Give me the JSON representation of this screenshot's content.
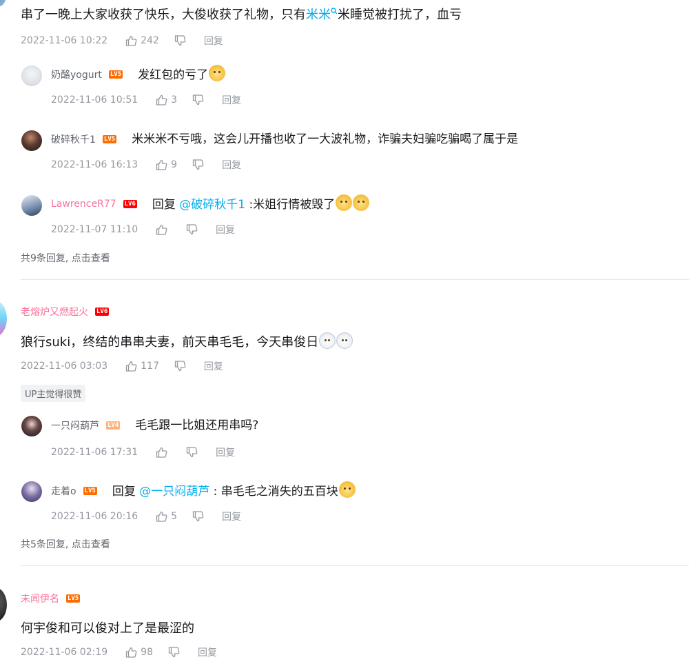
{
  "colors": {
    "accent_link": "#00aeec",
    "vip_name": "#fb7299",
    "meta": "#9499a0",
    "divider": "#e3e5e7"
  },
  "icons": [
    "thumb-up-icon",
    "thumb-down-icon",
    "search-icon",
    "emoji-doge",
    "emoji-white-face"
  ],
  "thread1": {
    "main": {
      "text_a": "串了一晚上大家收获了快乐，大俊收获了礼物，只有",
      "mention": "米米",
      "text_b": "米睡觉被打扰了，血亏",
      "date": "2022-11-06 10:22",
      "likes": "242",
      "reply": "回复"
    },
    "replies": [
      {
        "user": "奶酪yogurt",
        "level": "LV5",
        "text": "发红包的亏了",
        "date": "2022-11-06 10:51",
        "likes": "3",
        "reply": "回复"
      },
      {
        "user": "破碎秋千1",
        "level": "LV5",
        "text": "米米米不亏哦，这会儿开播也收了一大波礼物，诈骗夫妇骗吃骗喝了属于是",
        "date": "2022-11-06 16:13",
        "likes": "9",
        "reply": "回复"
      },
      {
        "user": "LawrenceR77",
        "level": "LV6",
        "prefix": "回复 ",
        "mention": "@破碎秋千1",
        "text": " :米姐行情被毁了",
        "date": "2022-11-07 11:10",
        "likes": "",
        "reply": "回复"
      }
    ],
    "more": "共9条回复, 点击查看"
  },
  "thread2": {
    "user": "老熔炉又燃起火",
    "level": "LV6",
    "text": "狼行suki，终结的串串夫妻，前天串毛毛，今天串俊日",
    "date": "2022-11-06 03:03",
    "likes": "117",
    "reply": "回复",
    "badge": "UP主觉得很赞",
    "replies": [
      {
        "user": "一只闷葫芦",
        "level": "LV4",
        "text": "毛毛跟一比姐还用串吗?",
        "date": "2022-11-06 17:31",
        "likes": "",
        "reply": "回复"
      },
      {
        "user": "走着o",
        "level": "LV5",
        "prefix": "回复 ",
        "mention": "@一只闷葫芦",
        "text": " : 串毛毛之消失的五百块",
        "date": "2022-11-06 20:16",
        "likes": "5",
        "reply": "回复"
      }
    ],
    "more": "共5条回复, 点击查看"
  },
  "thread3": {
    "user": "未闻伊名",
    "level": "LV5",
    "text": "何宇俊和可以俊对上了是最涩的",
    "date": "2022-11-06 02:19",
    "likes": "98",
    "reply": "回复"
  }
}
